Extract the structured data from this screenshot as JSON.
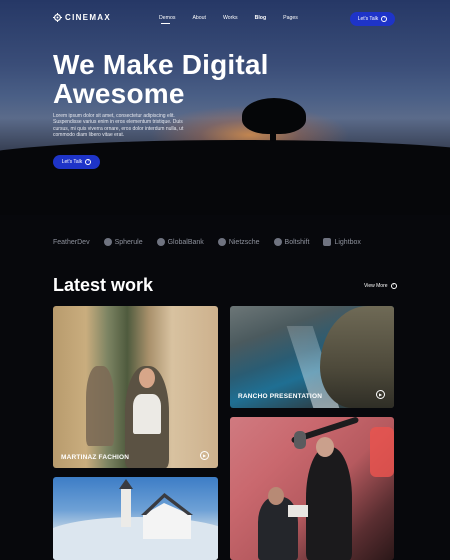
{
  "nav": {
    "logo": "CINEMAX",
    "items": [
      {
        "label": "Demos",
        "active": true
      },
      {
        "label": "About"
      },
      {
        "label": "Works"
      },
      {
        "label": "Blog"
      },
      {
        "label": "Pages"
      }
    ],
    "cta": "Let's Talk"
  },
  "hero": {
    "headline_line1": "We Make Digital",
    "headline_line2": "Awesome",
    "intro": "Lorem ipsum dolor sit amet, consectetur adipiscing elit. Suspendisse varius enim in eros elementum tristique. Duis cursus, mi quis viverra ornare, eros dolor interdum nulla, ut commodo diam libero vitae erat.",
    "cta": "Let's Talk"
  },
  "brands": [
    "FeatherDev",
    "Spherule",
    "GlobalBank",
    "Nietzsche",
    "Boltshift",
    "Lightbox"
  ],
  "work": {
    "title": "Latest work",
    "view_more": "View More",
    "cards": [
      {
        "caption": "MARTINAZ FACHION"
      },
      {
        "caption": "RANCHO PRESENTATION"
      }
    ]
  },
  "colors": {
    "accent": "#1e34c8",
    "background": "#07080c"
  }
}
